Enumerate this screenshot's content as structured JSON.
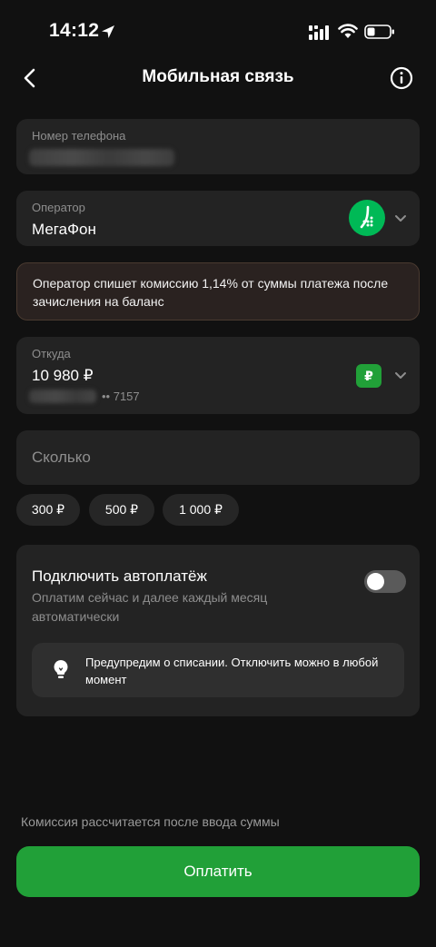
{
  "status_bar": {
    "time": "14:12"
  },
  "header": {
    "title": "Мобильная связь"
  },
  "phone_field": {
    "label": "Номер телефона"
  },
  "operator_field": {
    "label": "Оператор",
    "value": "МегаФон"
  },
  "commission_notice": {
    "text": "Оператор спишет комиссию 1,14% от суммы платежа после зачисления на баланс"
  },
  "source_field": {
    "label": "Откуда",
    "balance": "10 980 ₽",
    "currency_badge": "₽",
    "card_mask": "•• 7157"
  },
  "amount_field": {
    "placeholder": "Сколько"
  },
  "quick_amounts": [
    "300 ₽",
    "500 ₽",
    "1 000 ₽"
  ],
  "autopay": {
    "title": "Подключить автоплатёж",
    "description": "Оплатим сейчас и далее каждый месяц автоматически",
    "enabled": false,
    "tip": "Предупредим о списании. Отключить можно в любой момент"
  },
  "footer_note": "Комиссия рассчитается после ввода суммы",
  "pay_button_label": "Оплатить",
  "colors": {
    "background": "#111111",
    "card": "#232323",
    "accent_green": "#21a038",
    "notice_bg": "#2a2220",
    "secondary_text": "#8e8e8e"
  }
}
